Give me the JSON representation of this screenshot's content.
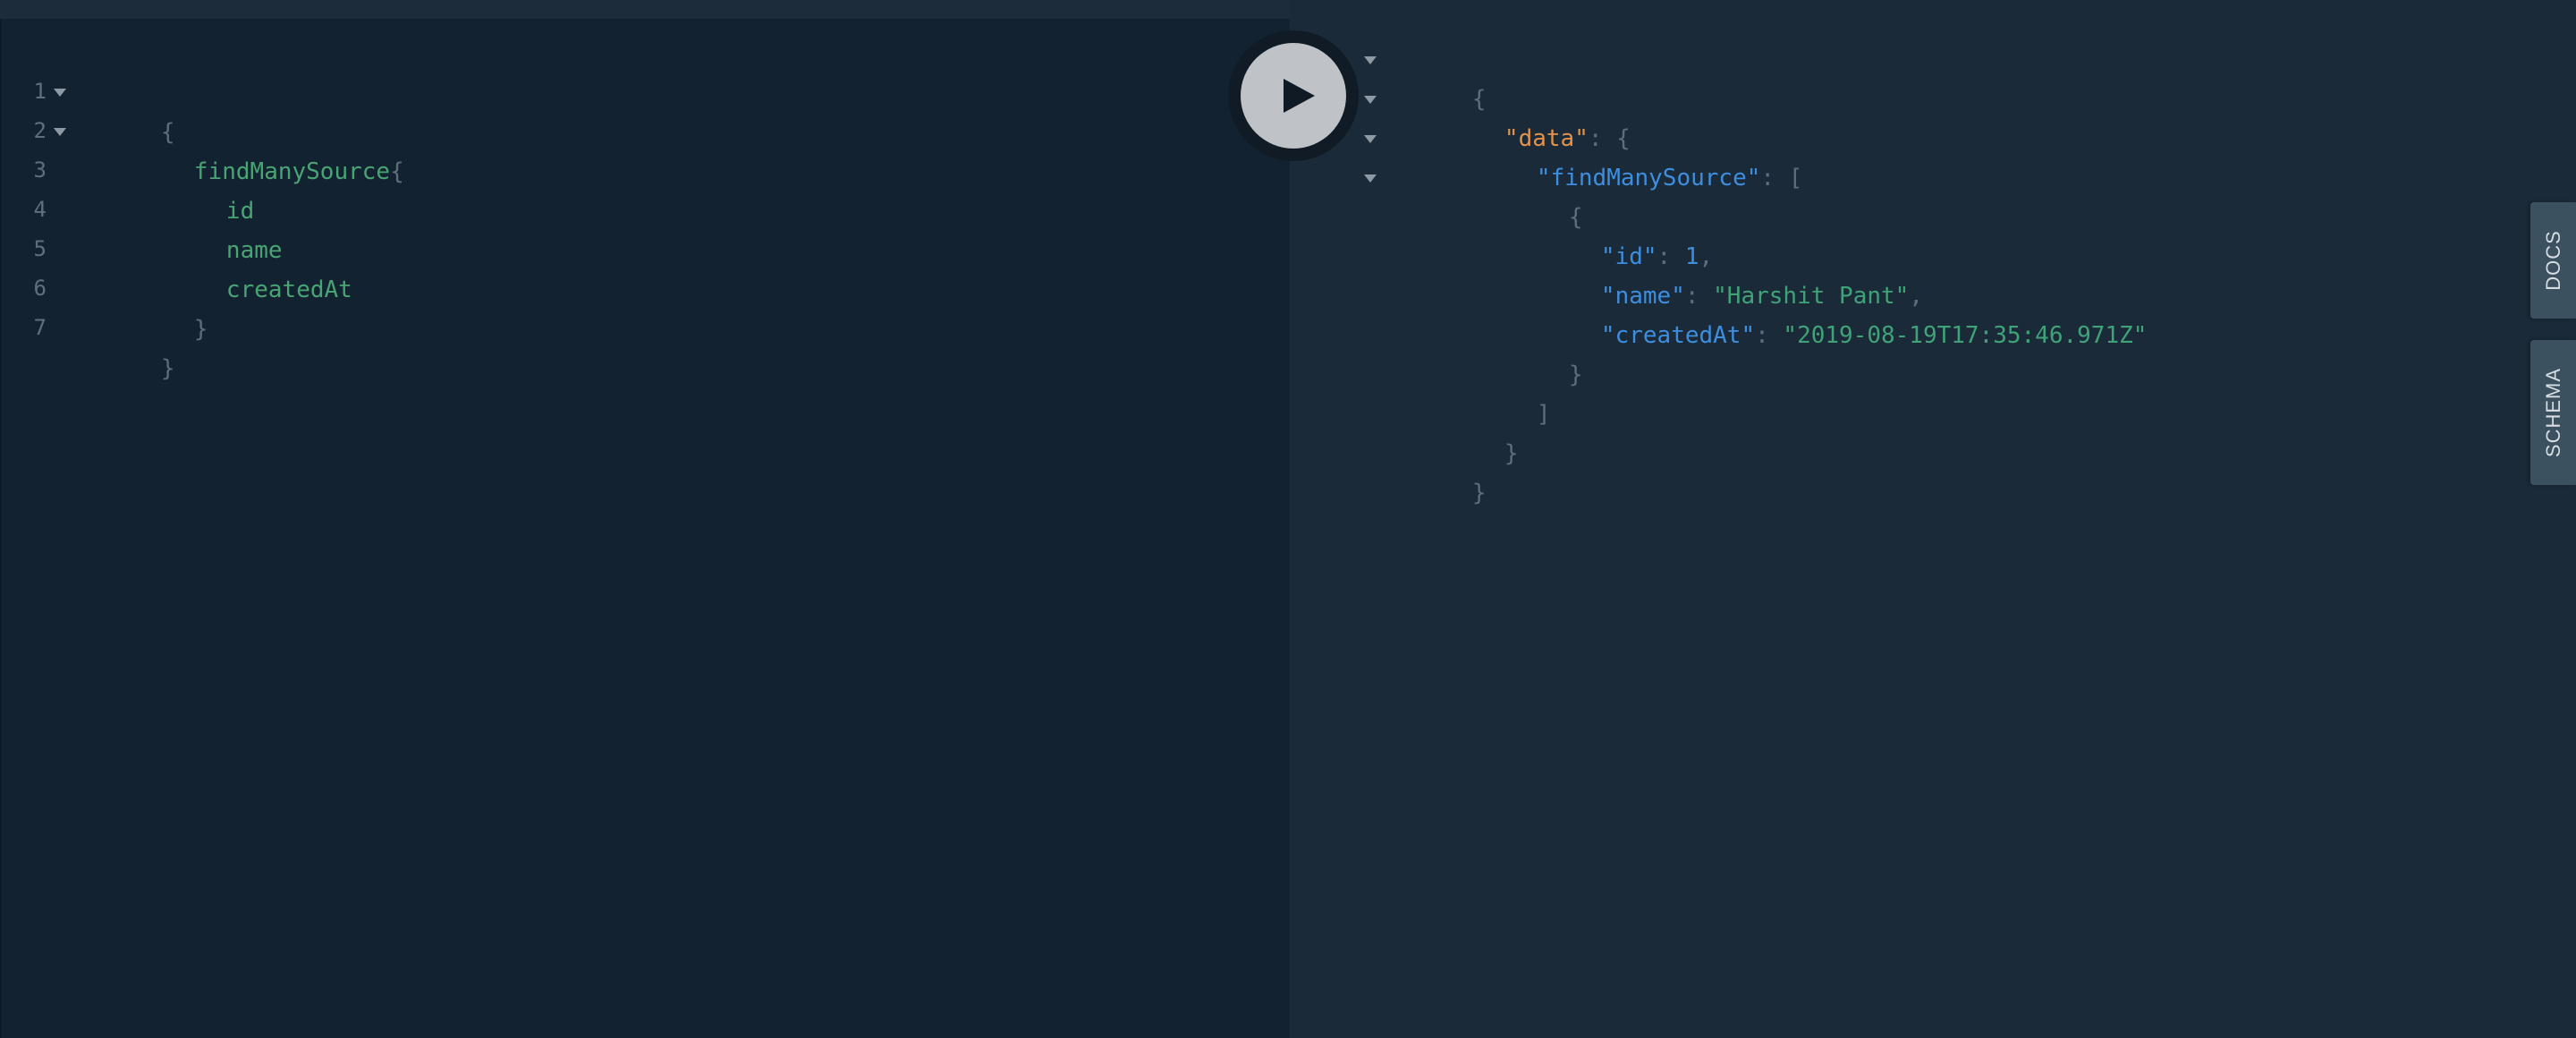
{
  "editor": {
    "line_numbers": [
      "1",
      "2",
      "3",
      "4",
      "5",
      "6",
      "7"
    ],
    "lines": {
      "l1_brace": "{",
      "l2_field": "findManySource",
      "l2_brace": "{",
      "l3_field": "id",
      "l4_field": "name",
      "l5_field": "createdAt",
      "l6_brace": "}",
      "l7_brace": "}"
    }
  },
  "result": {
    "open_brace": "{",
    "data_key": "\"data\"",
    "colon": ":",
    "data_open": "{",
    "source_key": "\"findManySource\"",
    "source_open": "[",
    "item_open": "{",
    "id_key": "\"id\"",
    "id_value": "1",
    "comma": ",",
    "name_key": "\"name\"",
    "name_value": "\"Harshit Pant\"",
    "created_key": "\"createdAt\"",
    "created_value": "\"2019-08-19T17:35:46.971Z\"",
    "item_close": "}",
    "source_close": "]",
    "data_close": "}",
    "close_brace": "}"
  },
  "side_tabs": {
    "docs": "DOCS",
    "schema": "SCHEMA"
  },
  "run_button": {
    "icon": "play-icon"
  },
  "colors": {
    "editor_bg": "#132230",
    "result_bg": "#1b2a39",
    "field": "#48a573",
    "key": "#3d8ede",
    "data_key": "#e2924b",
    "string": "#3fa377",
    "punctuation": "#5d6d7c"
  }
}
